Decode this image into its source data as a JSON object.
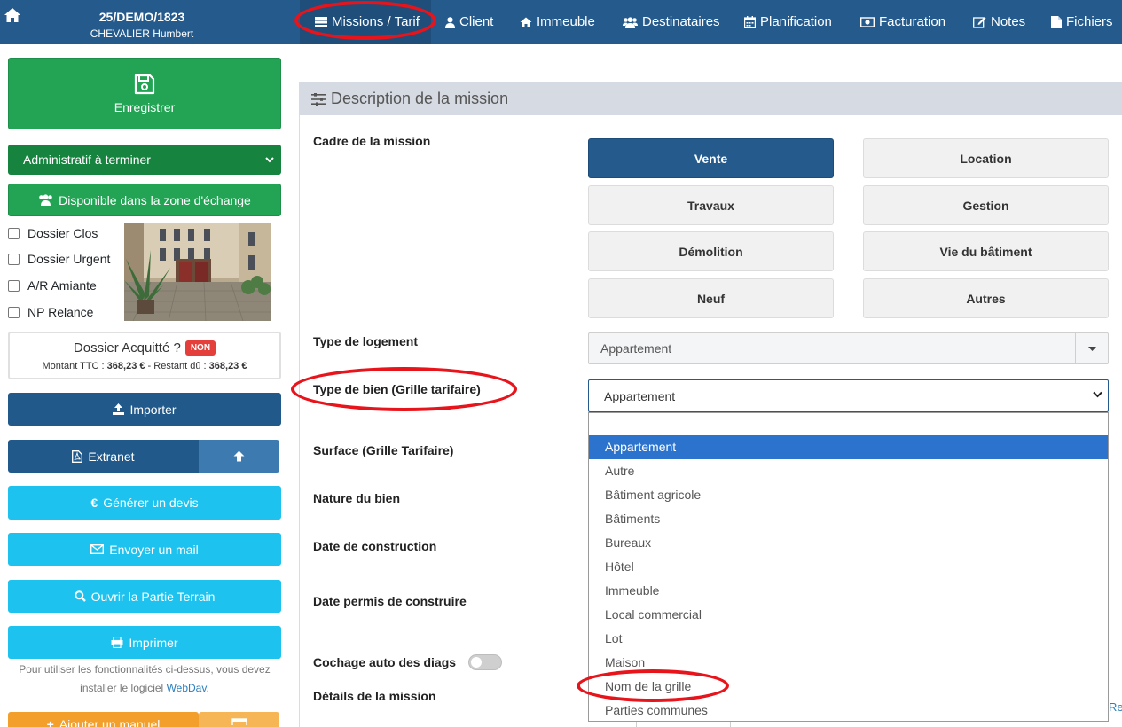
{
  "header": {
    "dossier_id": "25/DEMO/1823",
    "dossier_name": "CHEVALIER Humbert",
    "nav": [
      {
        "label": "Missions / Tarif",
        "icon": "list-icon",
        "active": true
      },
      {
        "label": "Client",
        "icon": "user-icon"
      },
      {
        "label": "Immeuble",
        "icon": "home-icon"
      },
      {
        "label": "Destinataires",
        "icon": "users-icon"
      },
      {
        "label": "Planification",
        "icon": "calendar-icon"
      },
      {
        "label": "Facturation",
        "icon": "money-icon"
      },
      {
        "label": "Notes",
        "icon": "edit-icon"
      },
      {
        "label": "Fichiers",
        "icon": "file-icon"
      }
    ]
  },
  "sidebar": {
    "save_label": "Enregistrer",
    "status_value": "Administratif à terminer",
    "exchange_label": "Disponible dans la zone d'échange",
    "checkboxes": [
      "Dossier Clos",
      "Dossier Urgent",
      "A/R Amiante",
      "NP Relance"
    ],
    "acquitte": {
      "title": "Dossier Acquitté ?",
      "badge": "NON",
      "montant_label": "Montant TTC : ",
      "montant_value": "368,23 €",
      "separator": " - ",
      "restant_label": "Restant dû : ",
      "restant_value": "368,23 €"
    },
    "import_label": "Importer",
    "extranet_label": "Extranet",
    "devis_label": "Générer un devis",
    "mail_label": "Envoyer un mail",
    "terrain_label": "Ouvrir la Partie Terrain",
    "print_label": "Imprimer",
    "webdav_note": "Pour utiliser les fonctionnalités ci-dessus, vous devez installer le logiciel ",
    "webdav_link": "WebDav",
    "webdav_end": ".",
    "add_label": "Ajouter un manuel"
  },
  "main": {
    "panel_title": "Description de la mission",
    "labels": {
      "cadre": "Cadre de la mission",
      "type_logement": "Type de logement",
      "type_bien": "Type de bien (Grille tarifaire)",
      "surface": "Surface (Grille Tarifaire)",
      "nature": "Nature du bien",
      "date_construction": "Date de construction",
      "date_permis": "Date permis de construire",
      "cochage": "Cochage auto des diags",
      "details": "Détails de la mission"
    },
    "cadre_options": [
      "Vente",
      "Location",
      "Travaux",
      "Gestion",
      "Démolition",
      "Vie du bâtiment",
      "Neuf",
      "Autres"
    ],
    "cadre_selected": "Vente",
    "type_logement_value": "Appartement",
    "type_bien_value": "Appartement",
    "type_bien_options": [
      "Appartement",
      "Autre",
      "Bâtiment agricole",
      "Bâtiments",
      "Bureaux",
      "Hôtel",
      "Immeuble",
      "Local commercial",
      "Lot",
      "Maison",
      "Nom de la grille",
      "Parties communes"
    ],
    "type_bien_highlighted": "Appartement",
    "cochage_enabled": false,
    "right_fragment": "Relie"
  },
  "colors": {
    "navbar": "#255a8c",
    "green": "#22a454",
    "navy": "#215a8a",
    "cyan": "#1ec2ee",
    "orange": "#f2a02b",
    "highlight": "#2b73cc",
    "annotation": "#e8141b"
  }
}
